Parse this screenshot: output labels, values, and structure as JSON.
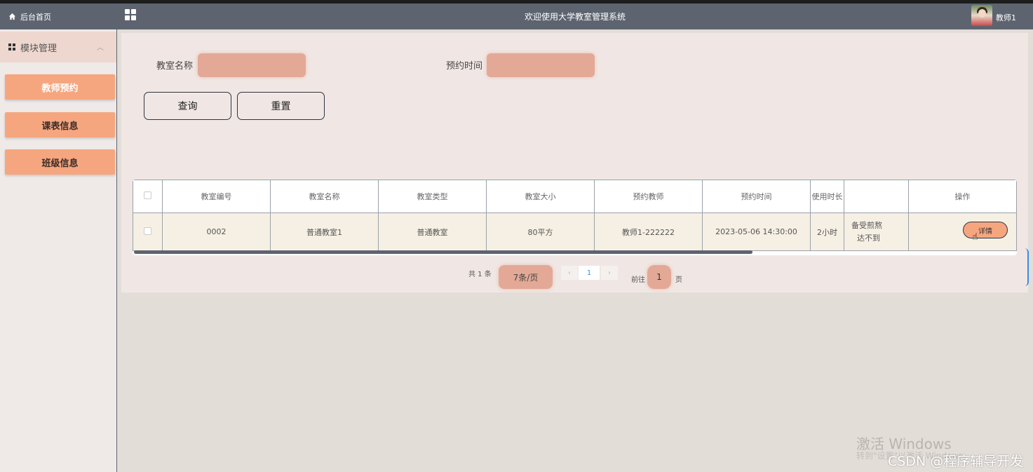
{
  "header": {
    "title": "欢迎使用大学教室管理系统",
    "user_name": "教师1"
  },
  "sidebar": {
    "home": "后台首页",
    "module": "模块管理",
    "items": [
      {
        "label": "教师预约"
      },
      {
        "label": "课表信息"
      },
      {
        "label": "班级信息"
      }
    ]
  },
  "search": {
    "name_label": "教室名称",
    "time_label": "预约时间",
    "query_button": "查询",
    "reset_button": "重置"
  },
  "table": {
    "headers": [
      "教室编号",
      "教室名称",
      "教室类型",
      "教室大小",
      "预约教师",
      "预约时间",
      "使用时长",
      "",
      "操作"
    ],
    "rows": [
      {
        "number": "0002",
        "name": "普通教室1",
        "type": "普通教室",
        "size": "80平方",
        "teacher": "教师1-222222",
        "time": "2023-05-06 14:30:00",
        "duration": "2小时",
        "note_line1": "备受煎熬",
        "note_line2": "达不到",
        "action": "详情"
      }
    ]
  },
  "pagination": {
    "total": "共 1 条",
    "page_size": "7条/页",
    "prev": "‹",
    "current": "1",
    "next": "›",
    "goto_label": "前往",
    "goto_value": "1",
    "page_suffix": "页"
  },
  "watermark": {
    "activate": "激活 Windows",
    "activate_sub": "转到\"设置\"以激活 Windows。",
    "csdn": "CSDN @程序辅导开发"
  },
  "colors": {
    "header_bg": "#5d6470",
    "accent": "#f6a67f",
    "input_fill": "#e3a996",
    "panel_bg": "#f0e7e4"
  }
}
